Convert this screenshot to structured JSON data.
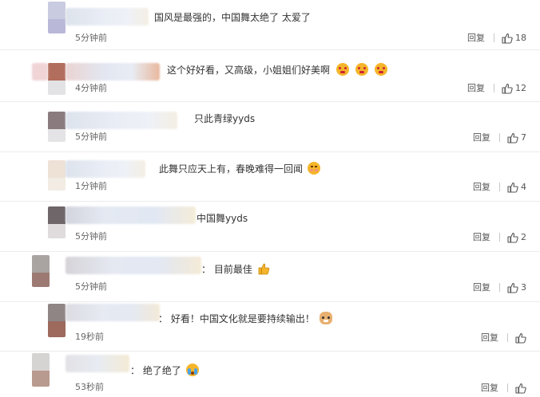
{
  "reply_label": "回复",
  "colors": {
    "emoji": "#f5b52a",
    "text": "#333333",
    "meta": "#666666"
  },
  "comments": [
    {
      "text": "国风是最强的，中国舞太绝了 太爱了",
      "emoji_names": [],
      "time": "5分钟前",
      "likes": "18"
    },
    {
      "text": "这个好好看，又高级，小姐姐们好美啊",
      "emoji_names": [
        "crying-face-icon",
        "crying-face-icon",
        "crying-face-icon"
      ],
      "time": "4分钟前",
      "likes": "12"
    },
    {
      "text": "只此青绿yyds",
      "emoji_names": [],
      "time": "5分钟前",
      "likes": "7"
    },
    {
      "text": "此舞只应天上有，春晚难得一回闻",
      "emoji_names": [
        "shy-face-icon"
      ],
      "time": "1分钟前",
      "likes": "4"
    },
    {
      "text": "中国舞yyds",
      "emoji_names": [],
      "time": "5分钟前",
      "likes": "2"
    },
    {
      "text": "：  目前最佳",
      "emoji_names": [
        "thumbs-up-icon"
      ],
      "time": "5分钟前",
      "likes": "3"
    },
    {
      "text": "：  好看！中国文化就是要持续输出！",
      "emoji_names": [
        "cat-face-icon"
      ],
      "time": "19秒前",
      "likes": ""
    },
    {
      "text": "：  绝了绝了",
      "emoji_names": [
        "loudly-crying-face-icon"
      ],
      "time": "53秒前",
      "likes": ""
    }
  ]
}
